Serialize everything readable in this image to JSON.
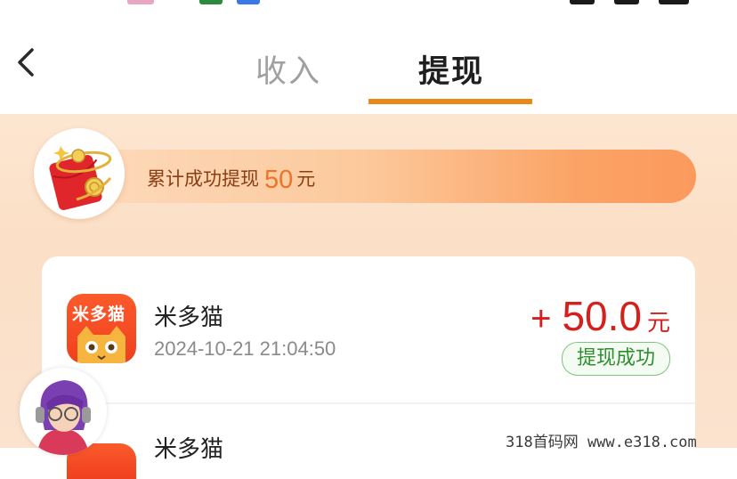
{
  "tabs": {
    "income_label": "收入",
    "withdraw_label": "提现",
    "active": "withdraw"
  },
  "summary": {
    "prefix": "累计成功提现",
    "amount": "50",
    "unit": "元"
  },
  "records": [
    {
      "icon_text": "米多猫",
      "app_name": "米多猫",
      "time": "2024-10-21 21:04:50",
      "sign": "+",
      "amount": "50.0",
      "unit": "元",
      "status": "提现成功"
    },
    {
      "app_name": "米多猫"
    }
  ],
  "watermark": "318首码网  www.e318.com",
  "colors": {
    "accent": "#e98a16",
    "amount": "#d5201b",
    "success": "#2e8f2e",
    "icon_bg": "#f0401f"
  }
}
